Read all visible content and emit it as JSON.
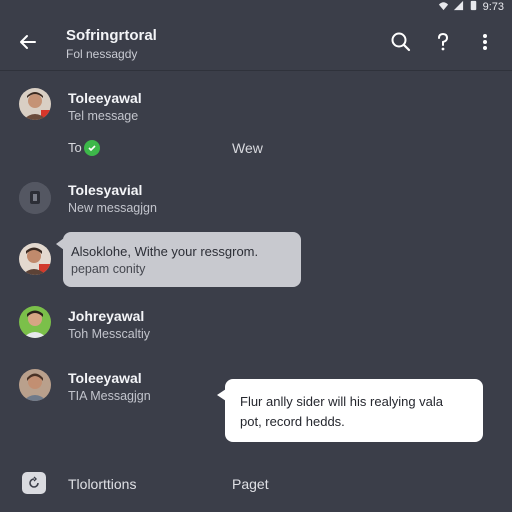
{
  "status": {
    "time": "9:73"
  },
  "header": {
    "title": "Sofringrtoral",
    "subtitle": "Fol nessagdy"
  },
  "threads": [
    {
      "name": "Toleeyawal",
      "message": "Tel message"
    },
    {
      "name": "Tolesyavial",
      "message": "New messagjgn"
    },
    {
      "name": "Johreyawal",
      "message": "Toh Messcaltiy"
    },
    {
      "name": "Toleeyawal",
      "message": "TIA Messagjgn"
    }
  ],
  "inline_row": {
    "left_label": "To",
    "right_label": "Wew"
  },
  "bubbles": {
    "gray": {
      "line1": "Alsoklohe, Withe your ressgrom.",
      "line2": "pepam conity"
    },
    "white": {
      "line1": "Flur anlly sider will his realying vala",
      "line2": "pot, record hedds."
    }
  },
  "bottom_bar": {
    "label_left": "Tlolorttions",
    "label_right": "Paget"
  },
  "colors": {
    "background": "#3b3e49",
    "accent_green": "#3db84a",
    "bubble_gray": "#c8c9cf"
  },
  "icons": [
    "back-arrow-icon",
    "search-icon",
    "help-icon",
    "more-vert-icon",
    "wifi-icon",
    "signal-icon",
    "battery-icon",
    "mic-icon",
    "check-icon",
    "refresh-icon"
  ]
}
